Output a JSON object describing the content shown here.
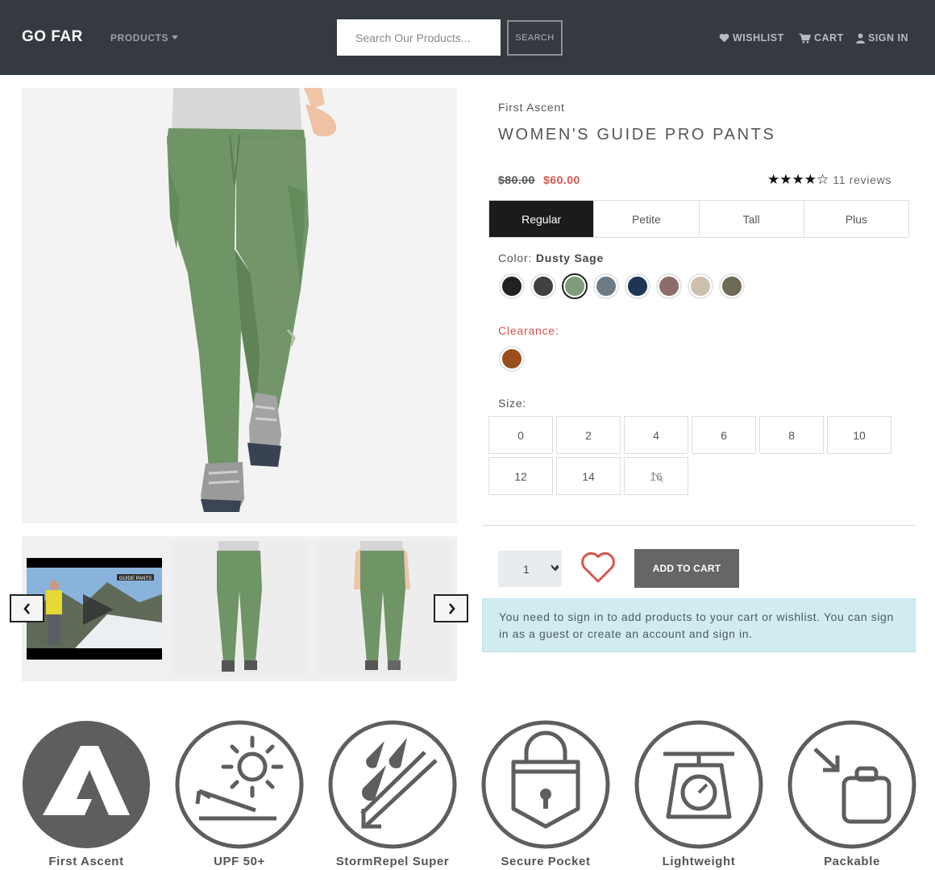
{
  "nav": {
    "brand": "GO FAR",
    "products": "PRODUCTS",
    "search_placeholder": "Search Our Products...",
    "search_button": "SEARCH",
    "wishlist": "WISHLIST",
    "cart": "CART",
    "sign_in": "SIGN IN"
  },
  "product": {
    "brand": "First Ascent",
    "title": "WOMEN'S GUIDE PRO PANTS",
    "price_original": "$80.00",
    "price_sale": "$60.00",
    "rating": 4,
    "rating_max": 5,
    "reviews": "11 reviews",
    "fits": [
      "Regular",
      "Petite",
      "Tall",
      "Plus"
    ],
    "fit_selected": "Regular",
    "color_label": "Color:",
    "color_selected": "Dusty Sage",
    "colors": [
      "#222222",
      "#404040",
      "#7f9c7a",
      "#6c7a86",
      "#1e3556",
      "#8d6d6a",
      "#cdbfae",
      "#6e6a57"
    ],
    "clearance_label": "Clearance:",
    "clearance_colors": [
      "#9a4e1e"
    ],
    "size_label": "Size:",
    "sizes": [
      "0",
      "2",
      "4",
      "6",
      "8",
      "10",
      "12",
      "14",
      "16"
    ],
    "sizes_unavailable": [
      "16"
    ],
    "quantity": "1",
    "add_to_cart": "ADD TO CART",
    "signin_notice": "You need to sign in to add products to your cart or wishlist. You can sign in as a guest or create an account and sign in."
  },
  "gallery": {
    "video_caption": "GUIDE PANTS"
  },
  "features": [
    {
      "label": "First Ascent",
      "icon": "first-ascent-logo-icon"
    },
    {
      "label": "UPF 50+",
      "icon": "sun-icon"
    },
    {
      "label": "StormRepel Super",
      "icon": "rain-repel-icon"
    },
    {
      "label": "Secure Pocket",
      "icon": "lock-pocket-icon"
    },
    {
      "label": "Lightweight",
      "icon": "scale-icon"
    },
    {
      "label": "Packable",
      "icon": "pack-icon"
    }
  ],
  "colors": {
    "navbar": "#343a40",
    "sale": "#d9534f",
    "active_tab": "#1b1b1b",
    "alert_bg": "#d1ecf1",
    "pants": "#6f9466"
  }
}
